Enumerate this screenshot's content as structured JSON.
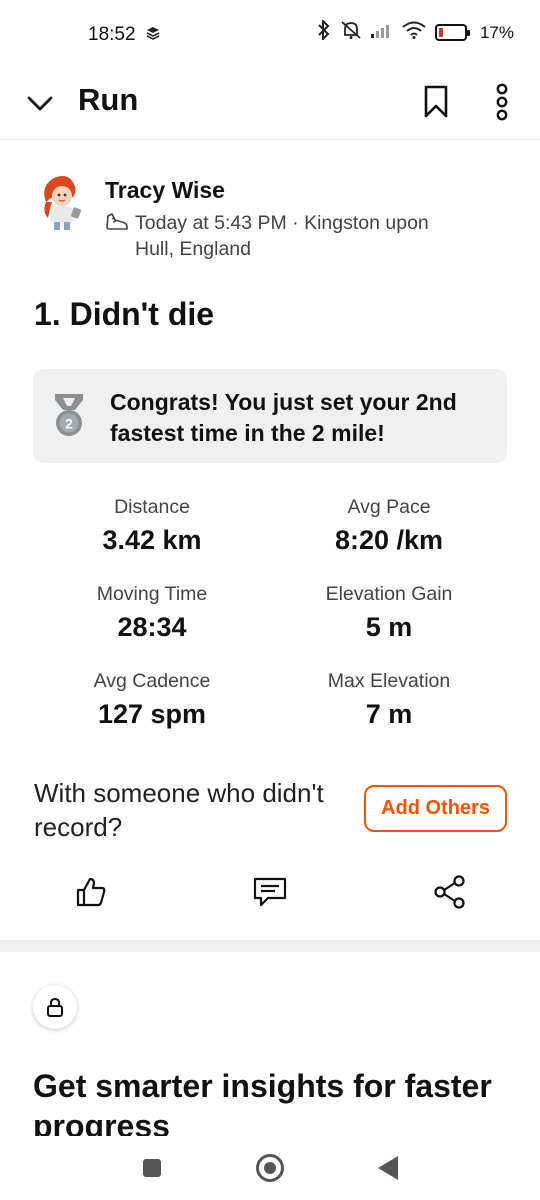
{
  "status_bar": {
    "time": "18:52",
    "battery_percent": "17%",
    "battery_level": 0.17,
    "battery_color": "#d32f2f",
    "icons": [
      "stack-icon",
      "bluetooth-icon",
      "muted-bell-icon",
      "signal-icon",
      "wifi-icon",
      "battery-icon"
    ]
  },
  "header": {
    "title": "Run",
    "icons": [
      "chevron-down-icon",
      "bookmark-icon",
      "more-vertical-icon"
    ]
  },
  "activity": {
    "athlete_name": "Tracy Wise",
    "meta_line1": "Today at 5:43 PM · Kingston upon",
    "meta_line2": "Hull, England",
    "meta_icon": "running-shoe-icon",
    "title": "1. Didn't die"
  },
  "achievement": {
    "medal_icon": "silver-medal-icon",
    "medal_rank": "2",
    "text": "Congrats! You just set your 2nd fastest time in the 2 mile!"
  },
  "stats": [
    {
      "label": "Distance",
      "value": "3.42 km"
    },
    {
      "label": "Avg Pace",
      "value": "8:20 /km"
    },
    {
      "label": "Moving Time",
      "value": "28:34"
    },
    {
      "label": "Elevation Gain",
      "value": "5 m"
    },
    {
      "label": "Avg Cadence",
      "value": "127 spm"
    },
    {
      "label": "Max Elevation",
      "value": "7 m"
    }
  ],
  "with_others": {
    "prompt": "With someone who didn't record?",
    "button_label": "Add Others",
    "accent_color": "#fc5200"
  },
  "actions": [
    "thumbs-up-icon",
    "comment-icon",
    "share-icon"
  ],
  "promo": {
    "lock_icon": "lock-icon",
    "title": "Get smarter insights for faster progress"
  },
  "nav": [
    "recents-square-icon",
    "home-circle-icon",
    "back-triangle-icon"
  ]
}
